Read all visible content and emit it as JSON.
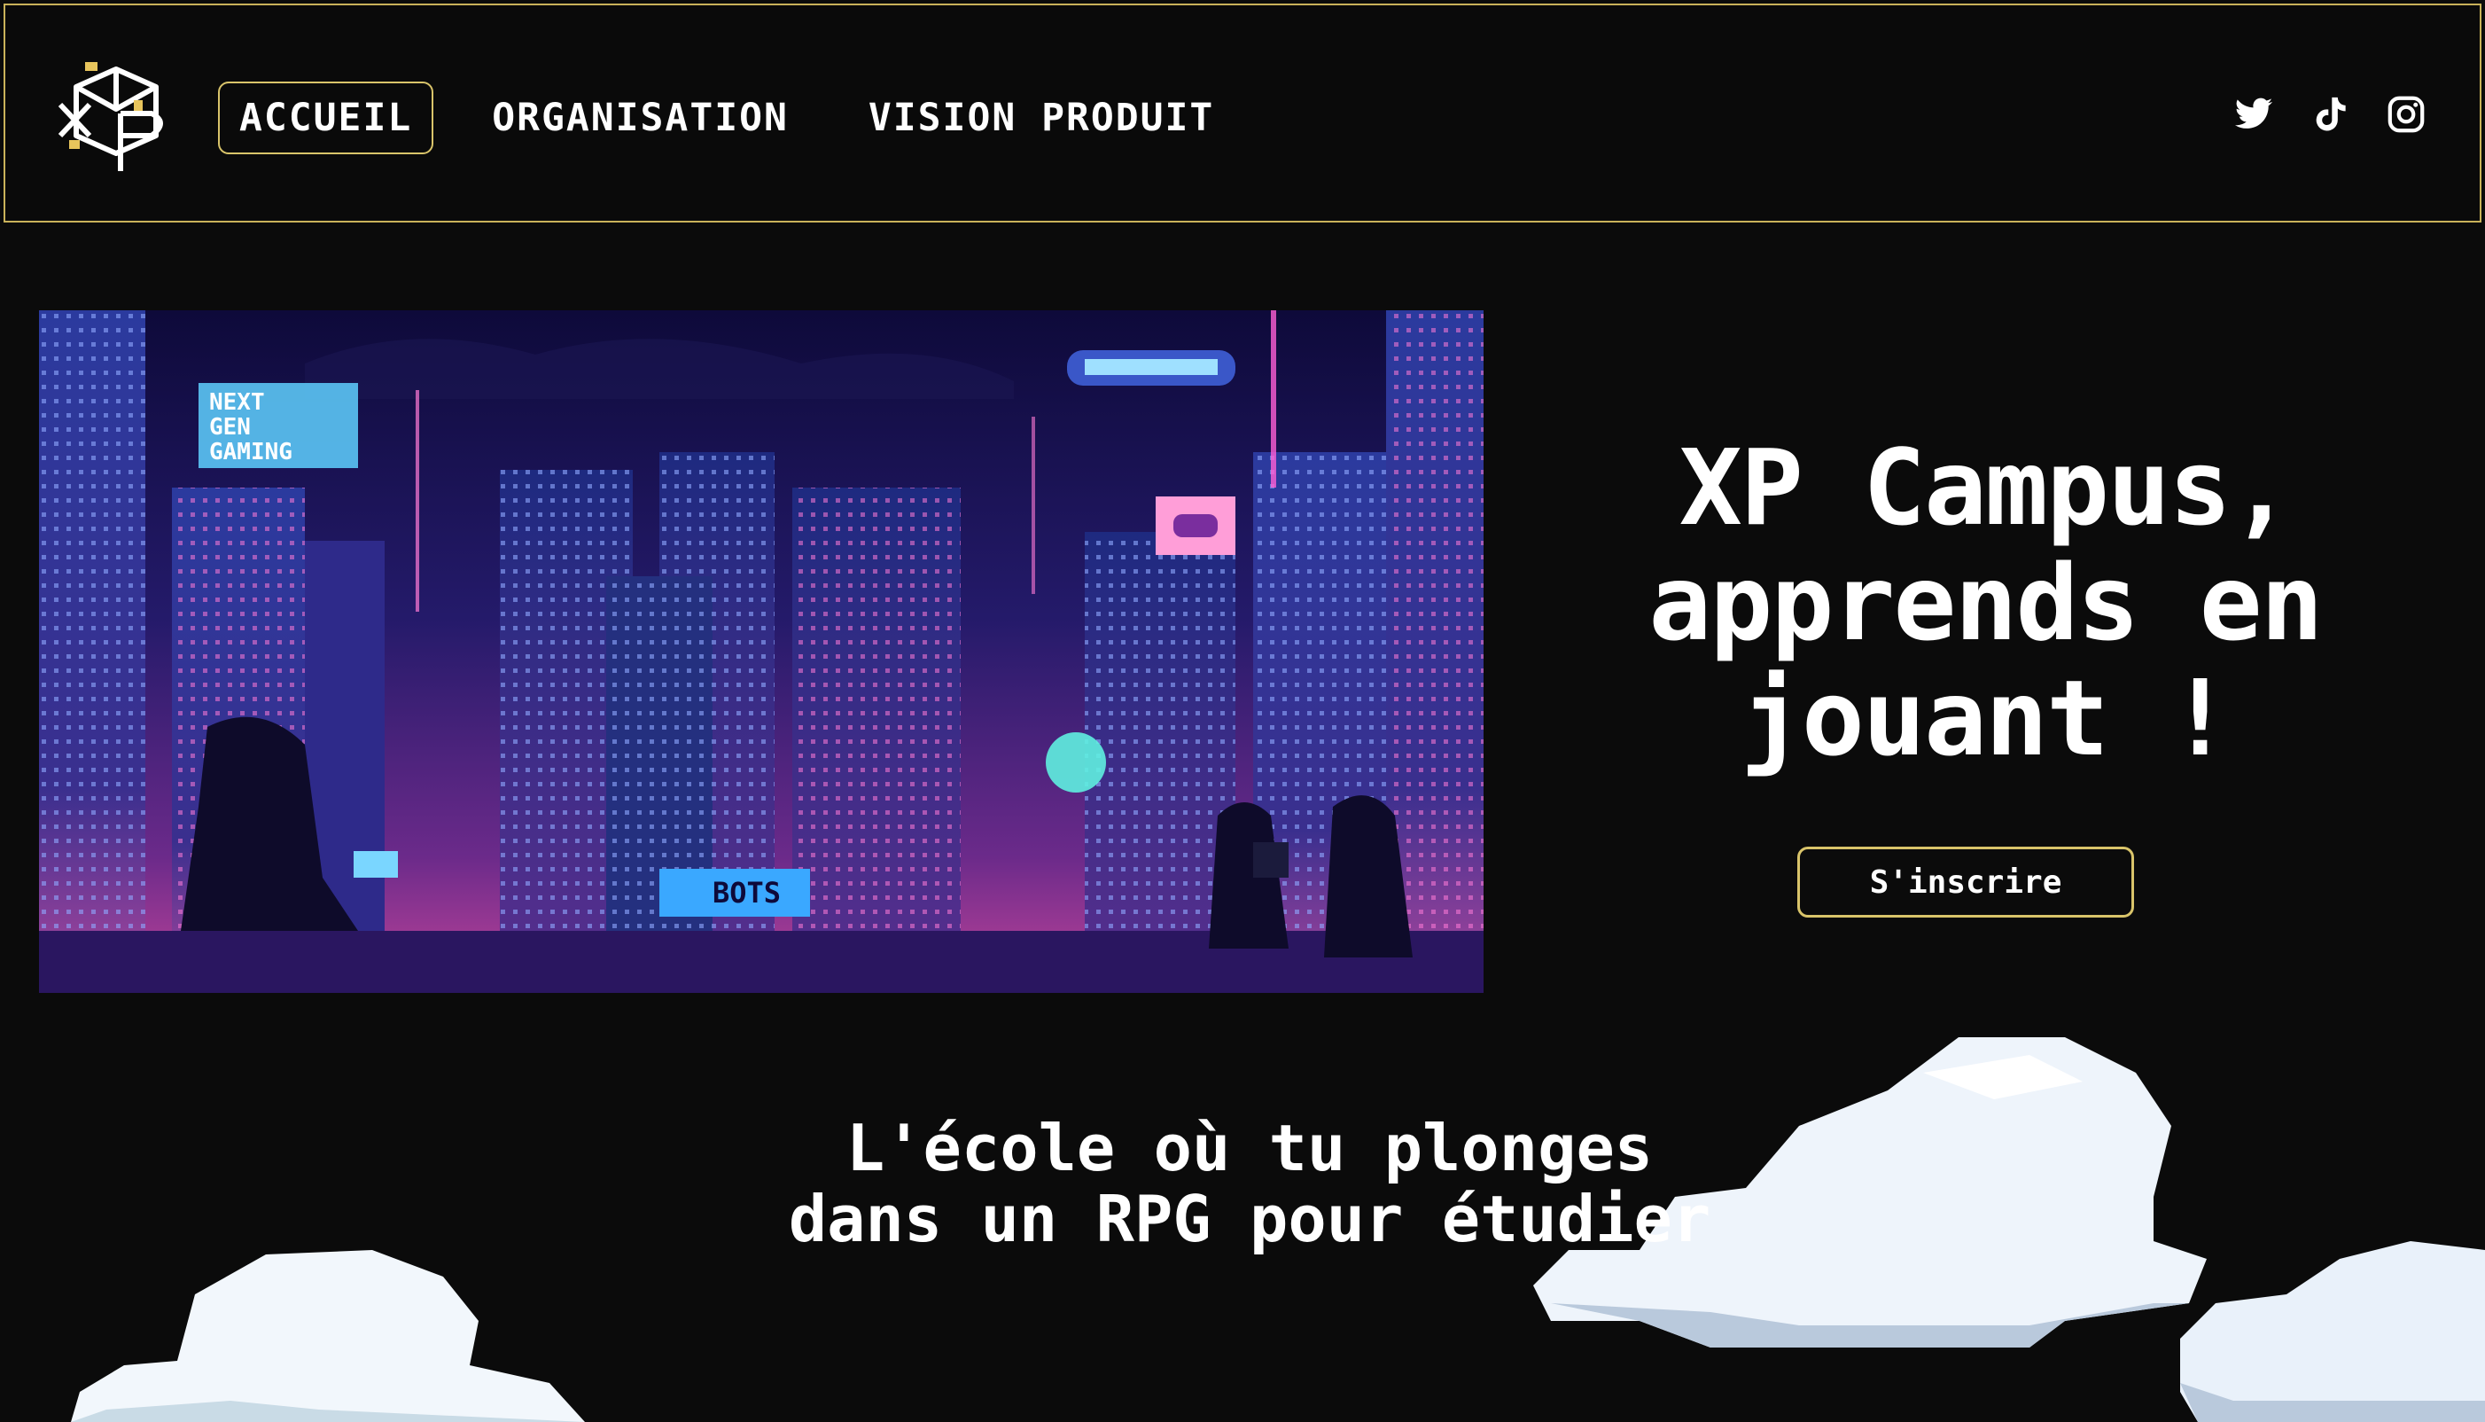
{
  "header": {
    "nav": [
      {
        "label": "ACCUEIL",
        "active": true
      },
      {
        "label": "ORGANISATION",
        "active": false
      },
      {
        "label": "VISION PRODUIT",
        "active": false
      }
    ],
    "socials": [
      "twitter-icon",
      "tiktok-icon",
      "instagram-icon"
    ]
  },
  "hero": {
    "title_line1": "XP Campus,",
    "title_line2": "apprends en",
    "title_line3": "jouant !",
    "cta_label": "S'inscrire",
    "illustration_signs": {
      "billboard": [
        "NEXT",
        "GEN",
        "GAMING"
      ],
      "bots_sign": "BOTS"
    }
  },
  "intro": {
    "line1": "L'école où tu plonges",
    "line2": "dans un RPG pour étudier"
  },
  "colors": {
    "background": "#0b0b0b",
    "accent_border": "#d9c46a",
    "text": "#ffffff"
  }
}
